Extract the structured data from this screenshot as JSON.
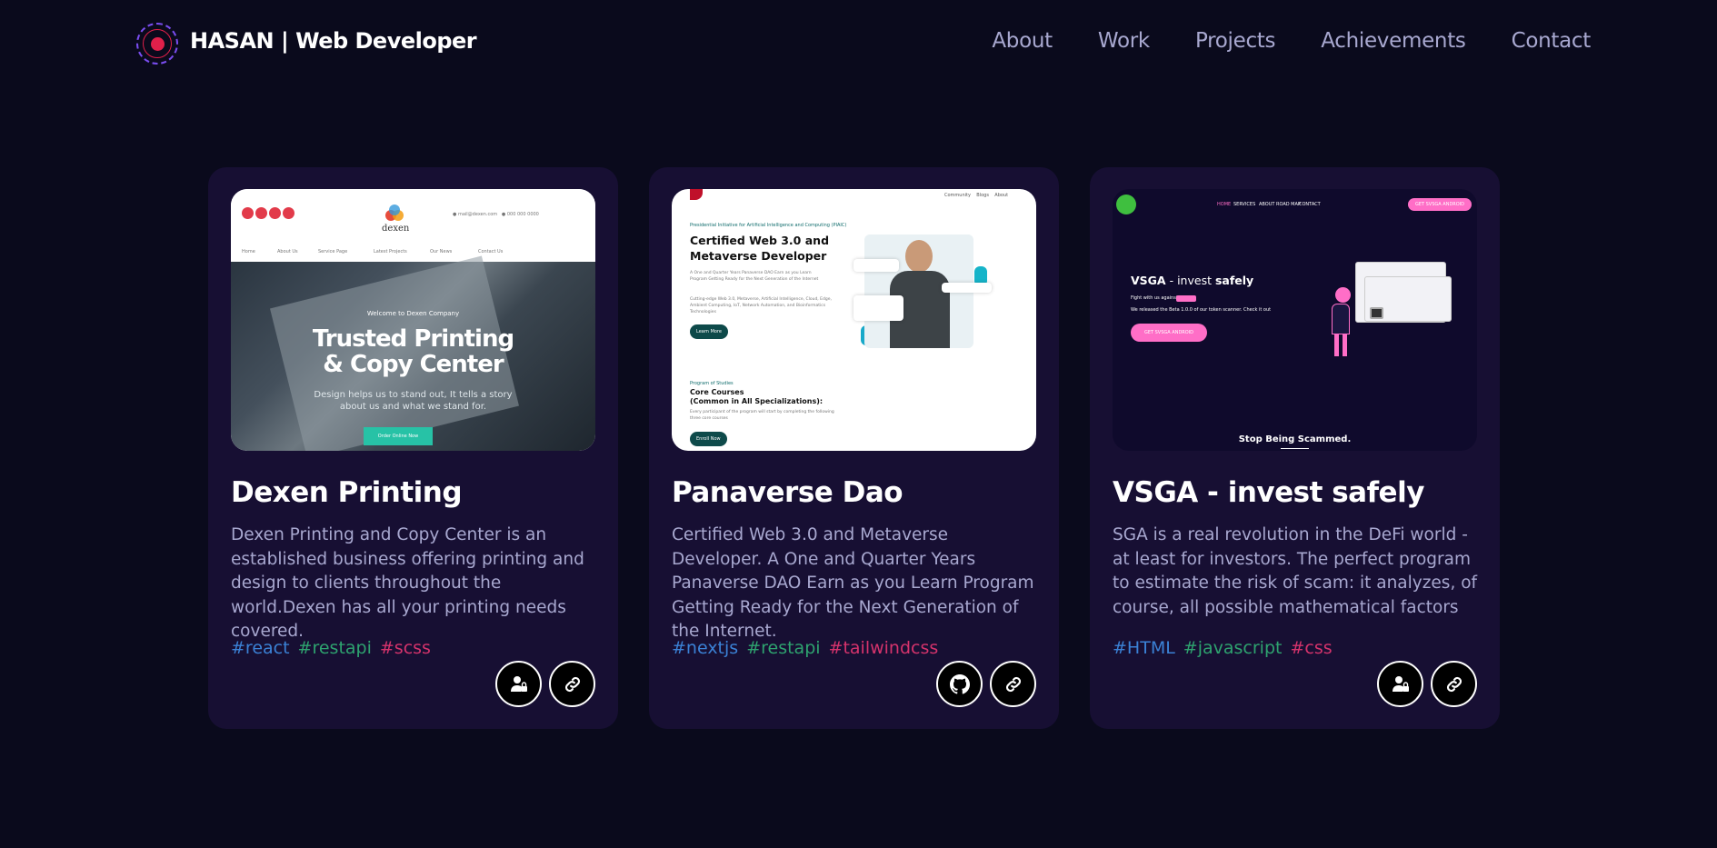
{
  "nav": {
    "brand": "HASAN  | Web Developer",
    "links": [
      "About",
      "Work",
      "Projects",
      "Achievements",
      "Contact"
    ]
  },
  "colors": {
    "background": "#0a0a1c",
    "card": "#170f33",
    "tag_blue": "#3b82d6",
    "tag_green": "#2ea36f",
    "tag_pink": "#d6336c",
    "muted_text": "#a8a8d0"
  },
  "projects": [
    {
      "title": "Dexen Printing",
      "description": "Dexen Printing and Copy Center is an established business offering printing and design to clients throughout the world.Dexen has all your printing needs covered.",
      "tags": [
        "#react",
        "#restapi",
        "#scss"
      ],
      "buttons": [
        "user-lock-icon",
        "link-icon"
      ],
      "preview": {
        "logo": "dexen",
        "welcome": "Welcome to Dexen Company",
        "headline1": "Trusted Printing",
        "headline2": "& Copy Center",
        "sub": "Design helps us to stand out, It tells a story about us and what we stand for.",
        "cta": "Order Online Now",
        "menu": [
          "Home",
          "About Us",
          "Service Page",
          "Latest Projects",
          "Our News",
          "Contact Us"
        ]
      }
    },
    {
      "title": "Panaverse Dao",
      "description": "Certified Web 3.0 and Metaverse Developer. A One and Quarter Years Panaverse DAO Earn as you Learn Program Getting Ready for the Next Generation of the Internet.",
      "tags": [
        "#nextjs",
        "#restapi",
        "#tailwindcss"
      ],
      "buttons": [
        "github-icon",
        "link-icon"
      ],
      "preview": {
        "kicker": "Presidential Initiative for Artificial Intelligence and Computing (PIAIC)",
        "headline1": "Certified Web 3.0 and",
        "headline2": "Metaverse Developer",
        "learn": "Learn More",
        "program": "Program of Studies",
        "core1": "Core Courses",
        "core2": "(Common in All Specializations):",
        "enroll": "Enroll Now"
      }
    },
    {
      "title": "VSGA - invest safely",
      "description": "SGA is a real revolution in the DeFi world - at least for investors. The perfect program to estimate the risk of scam: it analyzes, of course, all possible mathematical factors",
      "tags": [
        "#HTML",
        "#javascript",
        "#css"
      ],
      "buttons": [
        "user-lock-icon",
        "link-icon"
      ],
      "preview": {
        "menu": [
          "HOME",
          "SERVICES",
          "ABOUT",
          "ROAD MAP",
          "CONTACT"
        ],
        "top_btn": "GET SVSGA ANDROID",
        "headline_a": "VSGA",
        "headline_b": " - invest ",
        "headline_c": "safely",
        "line1": "Fight with us against",
        "line2": "We released the Beta 1.0.0 of our token scanner. Check it out",
        "cta": "GET SVSGA ANDROID",
        "footer": "Stop Being Scammed."
      }
    }
  ]
}
